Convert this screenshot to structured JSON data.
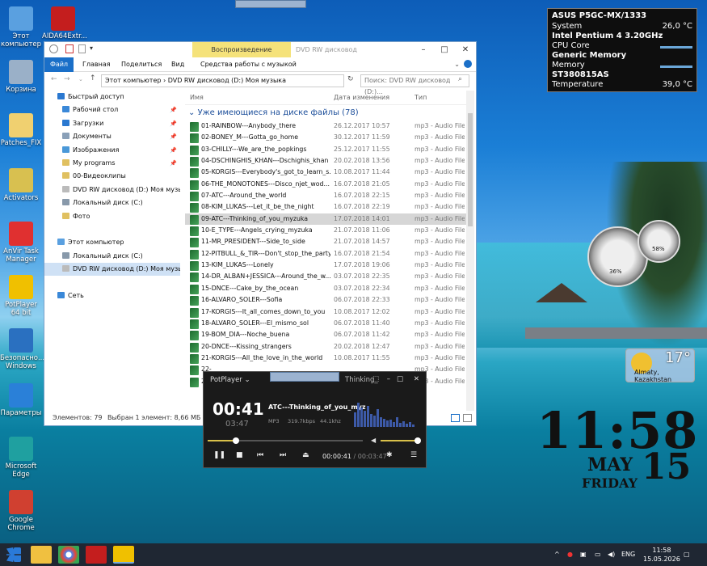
{
  "desktop_icons": [
    {
      "label": "Этот компьютер",
      "color": "#5aa0e0"
    },
    {
      "label": "AIDA64Extr...",
      "color": "#c41e1e"
    },
    {
      "label": "Корзина",
      "color": "#9ab0c8"
    },
    {
      "label": "Patches_FIX",
      "color": "#f0d070"
    },
    {
      "label": "Activators",
      "color": "#d8c050"
    },
    {
      "label": "AnVir Task Manager",
      "color": "#e03030"
    },
    {
      "label": "PotPlayer 64 bit",
      "color": "#f0c000"
    },
    {
      "label": "Безопасно... Windows",
      "color": "#2a70c0"
    },
    {
      "label": "Параметры",
      "color": "#2a80d8"
    },
    {
      "label": "Microsoft Edge",
      "color": "#1fa0a0"
    },
    {
      "label": "Google Chrome",
      "color": "#d04030"
    }
  ],
  "explorer": {
    "qat_labels": [
      "▾"
    ],
    "context_tab": "Воспроизведение",
    "title": "DVD RW дисковод",
    "ribbon_tabs": [
      "Файл",
      "Главная",
      "Поделиться",
      "Вид",
      "Средства работы с музыкой"
    ],
    "address": "Этот компьютер  ›  DVD RW дисковод (D:) Моя музыка",
    "search_placeholder": "Поиск: DVD RW дисковод (D:)...",
    "nav": [
      {
        "label": "Быстрый доступ",
        "pin": false,
        "color": "#2a78d0",
        "indent": 0
      },
      {
        "label": "Рабочий стол",
        "pin": true,
        "color": "#3a88d8",
        "indent": 1
      },
      {
        "label": "Загрузки",
        "pin": true,
        "color": "#2a78d0",
        "indent": 1
      },
      {
        "label": "Документы",
        "pin": true,
        "color": "#8aa0b8",
        "indent": 1
      },
      {
        "label": "Изображения",
        "pin": true,
        "color": "#4a98d8",
        "indent": 1
      },
      {
        "label": "My programs",
        "pin": true,
        "color": "#e0c060",
        "indent": 1
      },
      {
        "label": "00-Видеоклипы",
        "pin": false,
        "color": "#e0c060",
        "indent": 1
      },
      {
        "label": "DVD RW дисковод (D:) Моя музыка",
        "pin": false,
        "color": "#bbbbbb",
        "indent": 1
      },
      {
        "label": "Локальный диск (C:)",
        "pin": false,
        "color": "#8899aa",
        "indent": 1
      },
      {
        "label": "Фото",
        "pin": false,
        "color": "#e0c060",
        "indent": 1
      },
      {
        "label": "",
        "pin": false,
        "color": "",
        "indent": 0
      },
      {
        "label": "Этот компьютер",
        "pin": false,
        "color": "#5aa0e0",
        "indent": 0
      },
      {
        "label": "Локальный диск (C:)",
        "pin": false,
        "color": "#8899aa",
        "indent": 1
      },
      {
        "label": "DVD RW дисковод (D:) Моя музыка",
        "pin": false,
        "color": "#bbbbbb",
        "indent": 1,
        "selected": true
      },
      {
        "label": "",
        "pin": false,
        "color": "",
        "indent": 0
      },
      {
        "label": "Сеть",
        "pin": false,
        "color": "#3a88d8",
        "indent": 0
      }
    ],
    "columns": [
      "Имя",
      "Дата изменения",
      "Тип"
    ],
    "group": "Уже имеющиеся на диске файлы (78)",
    "files": [
      [
        "01-RAINBOW---Anybody_there",
        "26.12.2017 10:57",
        "mp3 - Audio File"
      ],
      [
        "02-BONEY_M---Gotta_go_home",
        "30.12.2017 11:59",
        "mp3 - Audio File"
      ],
      [
        "03-CHILLY---We_are_the_popkings",
        "25.12.2017 11:55",
        "mp3 - Audio File"
      ],
      [
        "04-DSCHINGHIS_KHAN---Dschighis_khan",
        "20.02.2018 13:56",
        "mp3 - Audio File"
      ],
      [
        "05-KORGIS---Everybody's_got_to_learn_s...",
        "10.08.2017 11:44",
        "mp3 - Audio File"
      ],
      [
        "06-THE_MONOTONES---Disco_njet_wod...",
        "16.07.2018 21:05",
        "mp3 - Audio File"
      ],
      [
        "07-ATC---Around_the_world",
        "16.07.2018 22:15",
        "mp3 - Audio File"
      ],
      [
        "08-KIM_LUKAS---Let_it_be_the_night",
        "16.07.2018 22:19",
        "mp3 - Audio File"
      ],
      [
        "09-ATC---Thinking_of_you_myzuka",
        "17.07.2018 14:01",
        "mp3 - Audio File"
      ],
      [
        "10-E_TYPE---Angels_crying_myzuka",
        "21.07.2018 11:06",
        "mp3 - Audio File"
      ],
      [
        "11-MR_PRESIDENT---Side_to_side",
        "21.07.2018 14:57",
        "mp3 - Audio File"
      ],
      [
        "12-PITBULL_&_TIR---Don't_stop_the_party",
        "16.07.2018 21:54",
        "mp3 - Audio File"
      ],
      [
        "13-KIM_LUKAS---Lonely",
        "17.07.2018 19:06",
        "mp3 - Audio File"
      ],
      [
        "14-DR_ALBAN+JESSICA---Around_the_w...",
        "03.07.2018 22:35",
        "mp3 - Audio File"
      ],
      [
        "15-DNCE---Cake_by_the_ocean",
        "03.07.2018 22:34",
        "mp3 - Audio File"
      ],
      [
        "16-ALVARO_SOLER---Sofia",
        "06.07.2018 22:33",
        "mp3 - Audio File"
      ],
      [
        "17-KORGIS---It_all_comes_down_to_you",
        "10.08.2017 12:02",
        "mp3 - Audio File"
      ],
      [
        "18-ALVARO_SOLER---El_mismo_sol",
        "06.07.2018 11:40",
        "mp3 - Audio File"
      ],
      [
        "19-BOM_DIA---Noche_buena",
        "06.07.2018 11:42",
        "mp3 - Audio File"
      ],
      [
        "20-DNCE---Kissing_strangers",
        "20.02.2018 12:47",
        "mp3 - Audio File"
      ],
      [
        "21-KORGIS---All_the_love_in_the_world",
        "10.08.2017 11:55",
        "mp3 - Audio File"
      ],
      [
        "22-",
        "",
        "mp3 - Audio File"
      ],
      [
        "23-",
        "",
        "mp3 - Audio File"
      ]
    ],
    "selected_index": 8,
    "status_items": "Элементов: 79",
    "status_selected": "Выбран 1 элемент: 8,66 МБ"
  },
  "player": {
    "app": "PotPlayer",
    "tab_title": "Thinking_",
    "time": "00:41",
    "duration": "03:47",
    "track": "ATC---Thinking_of_you_myz",
    "format": "MP3",
    "bitrate": "319.7kbps",
    "rate": "44.1khz",
    "progress": 0.18,
    "volume": 1.0,
    "time_readout": "00:00:41",
    "total_readout": "/ 00:03:47"
  },
  "sysmon": {
    "board": "ASUS P5GC-MX/1333",
    "system_label": "System",
    "system_val": "26,0 °C",
    "cpu": "Intel Pentium 4 3.20GHz",
    "cpu_label": "CPU Core",
    "mem": "Generic Memory",
    "mem_label": "Memory",
    "disk": "ST380815AS",
    "temp_label": "Temperature",
    "temp_val": "39,0 °C"
  },
  "gauges": {
    "cpu": "36%",
    "mem": "58%"
  },
  "weather": {
    "temp": "17°",
    "city": "Almaty, Kazakhstan"
  },
  "clock": {
    "time": "11:58",
    "month": "MAY",
    "day": "15",
    "dow": "FRIDAY"
  },
  "tray": {
    "lang": "ENG",
    "time": "11:58",
    "date": "15.05.2026"
  }
}
